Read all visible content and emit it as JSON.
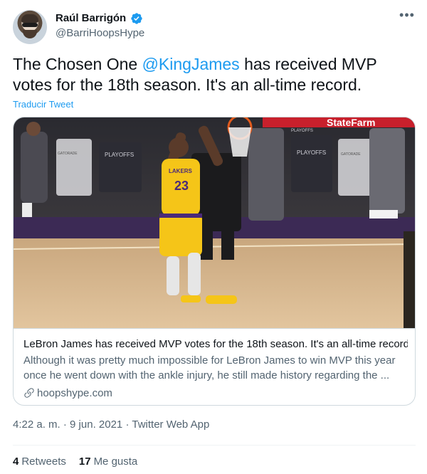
{
  "author": {
    "name": "Raúl Barrigón",
    "handle": "@BarriHoopsHype",
    "verified": true
  },
  "tweet": {
    "text_before": "The Chosen One ",
    "mention": "@KingJames",
    "text_after": " has received MVP votes for the 18th season. It's an all-time record.",
    "translate_label": "Traducir Tweet"
  },
  "card": {
    "title": "LeBron James has received MVP votes for the 18th season. It's an all-time record",
    "description": "Although it was pretty much impossible for LeBron James to win MVP this year once he went down with the ankle injury, he still made history regarding the ...",
    "domain": "hoopshype.com",
    "image_text": {
      "banner": "StateFarm",
      "playoffs_left": "PLAYOFFS",
      "playoffs_right": "PLAYOFFS",
      "playoffs_top": "PLAYOFFS",
      "gatorade_left": "GATORADE",
      "gatorade_right": "GATORADE",
      "jersey_name": "LAKERS",
      "jersey_number": "23"
    }
  },
  "meta": {
    "time": "4:22 a. m.",
    "date": "9 jun. 2021",
    "source": "Twitter Web App",
    "separator": "·"
  },
  "stats": {
    "retweets_count": "4",
    "retweets_label": "Retweets",
    "likes_count": "17",
    "likes_label": "Me gusta"
  },
  "colors": {
    "accent": "#1d9bf0",
    "text_primary": "#0f1419",
    "text_secondary": "#536471",
    "border": "#cfd9de"
  },
  "icons": [
    "verified-badge-icon",
    "more-options-icon",
    "link-icon"
  ]
}
